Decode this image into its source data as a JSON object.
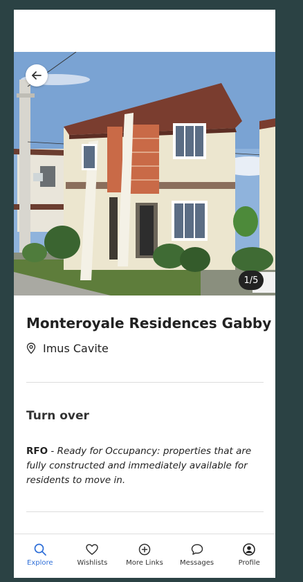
{
  "listing": {
    "title": "Monteroyale Residences Gabby",
    "location": "Imus Cavite",
    "photo_counter": "1/5"
  },
  "turnover": {
    "heading": "Turn over",
    "label": "RFO",
    "separator": " - ",
    "description": "Ready for Occupancy: properties that are fully constructed and immediately available for residents to move in."
  },
  "tabs": [
    {
      "label": "Explore",
      "icon": "search-icon",
      "active": true
    },
    {
      "label": "Wishlists",
      "icon": "heart-icon",
      "active": false
    },
    {
      "label": "More Links",
      "icon": "plus-circle-icon",
      "active": false
    },
    {
      "label": "Messages",
      "icon": "chat-bubble-icon",
      "active": false
    },
    {
      "label": "Profile",
      "icon": "user-icon",
      "active": false
    }
  ],
  "colors": {
    "background": "#2b4244",
    "accent": "#2f6fd8",
    "text": "#222222"
  }
}
